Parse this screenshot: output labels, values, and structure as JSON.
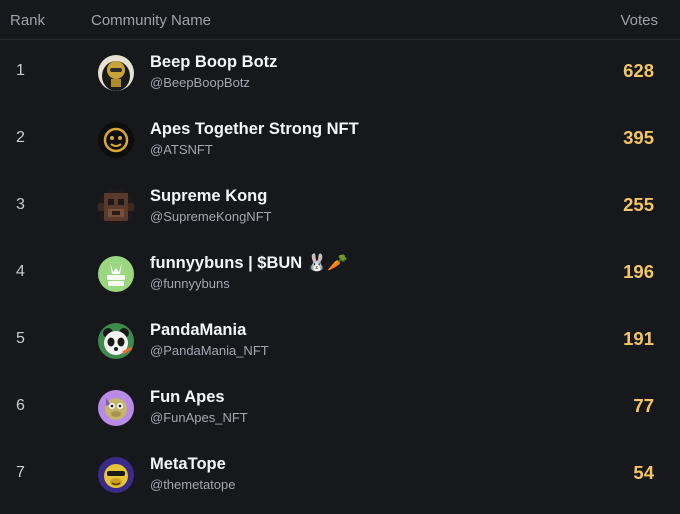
{
  "header": {
    "rank_label": "Rank",
    "name_label": "Community Name",
    "votes_label": "Votes"
  },
  "colors": {
    "background": "#17181c",
    "votes_accent": "#f4c565",
    "header_text": "#9ea3ad"
  },
  "rows": [
    {
      "rank": "1",
      "name": "Beep Boop Botz",
      "handle": "@BeepBoopBotz",
      "votes": "628",
      "avatar_icon": "gold-robot-avatar-icon"
    },
    {
      "rank": "2",
      "name": "Apes Together Strong NFT",
      "handle": "@ATSNFT",
      "votes": "395",
      "avatar_icon": "gold-ape-avatar-icon"
    },
    {
      "rank": "3",
      "name": "Supreme Kong",
      "handle": "@SupremeKongNFT",
      "votes": "255",
      "avatar_icon": "pixel-kong-avatar-icon"
    },
    {
      "rank": "4",
      "name": "funnyybuns | $BUN 🐰🥕",
      "handle": "@funnyybuns",
      "votes": "196",
      "avatar_icon": "green-bunny-avatar-icon"
    },
    {
      "rank": "5",
      "name": "PandaMania",
      "handle": "@PandaMania_NFT",
      "votes": "191",
      "avatar_icon": "panda-avatar-icon"
    },
    {
      "rank": "6",
      "name": "Fun Apes",
      "handle": "@FunApes_NFT",
      "votes": "77",
      "avatar_icon": "purple-ape-avatar-icon"
    },
    {
      "rank": "7",
      "name": "MetaTope",
      "handle": "@themetatope",
      "votes": "54",
      "avatar_icon": "purple-monkey-avatar-icon"
    }
  ]
}
